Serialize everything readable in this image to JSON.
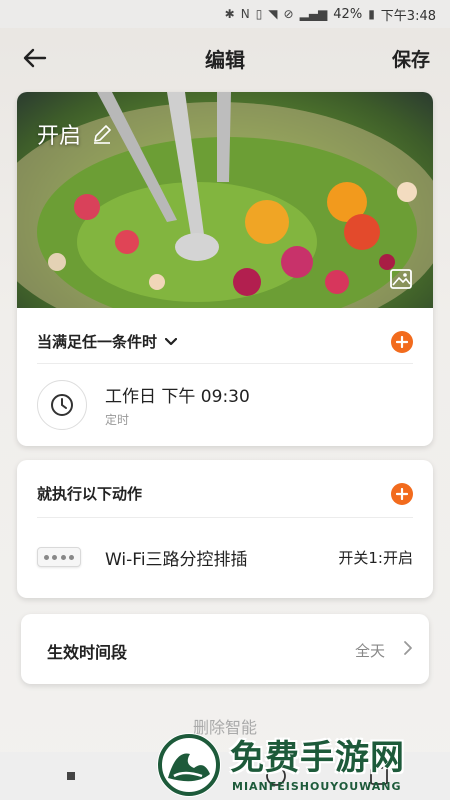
{
  "status_bar": {
    "battery": "42%",
    "time": "下午3:48"
  },
  "header": {
    "title": "编辑",
    "save_label": "保存"
  },
  "scene": {
    "name": "开启"
  },
  "conditions": {
    "title": "当满足任一条件时",
    "items": [
      {
        "main": "工作日 下午 09:30",
        "sub": "定时"
      }
    ]
  },
  "actions": {
    "title": "就执行以下动作",
    "items": [
      {
        "device": "Wi-Fi三路分控排插",
        "state": "开关1:开启"
      }
    ]
  },
  "effective_period": {
    "label": "生效时间段",
    "value": "全天"
  },
  "delete_label": "删除智能",
  "watermark": {
    "title": "免费手游网",
    "subtitle": "MIANFEISHOUYOUWANG"
  },
  "colors": {
    "accent": "#f26b1d",
    "watermark": "#1d5a3a"
  }
}
